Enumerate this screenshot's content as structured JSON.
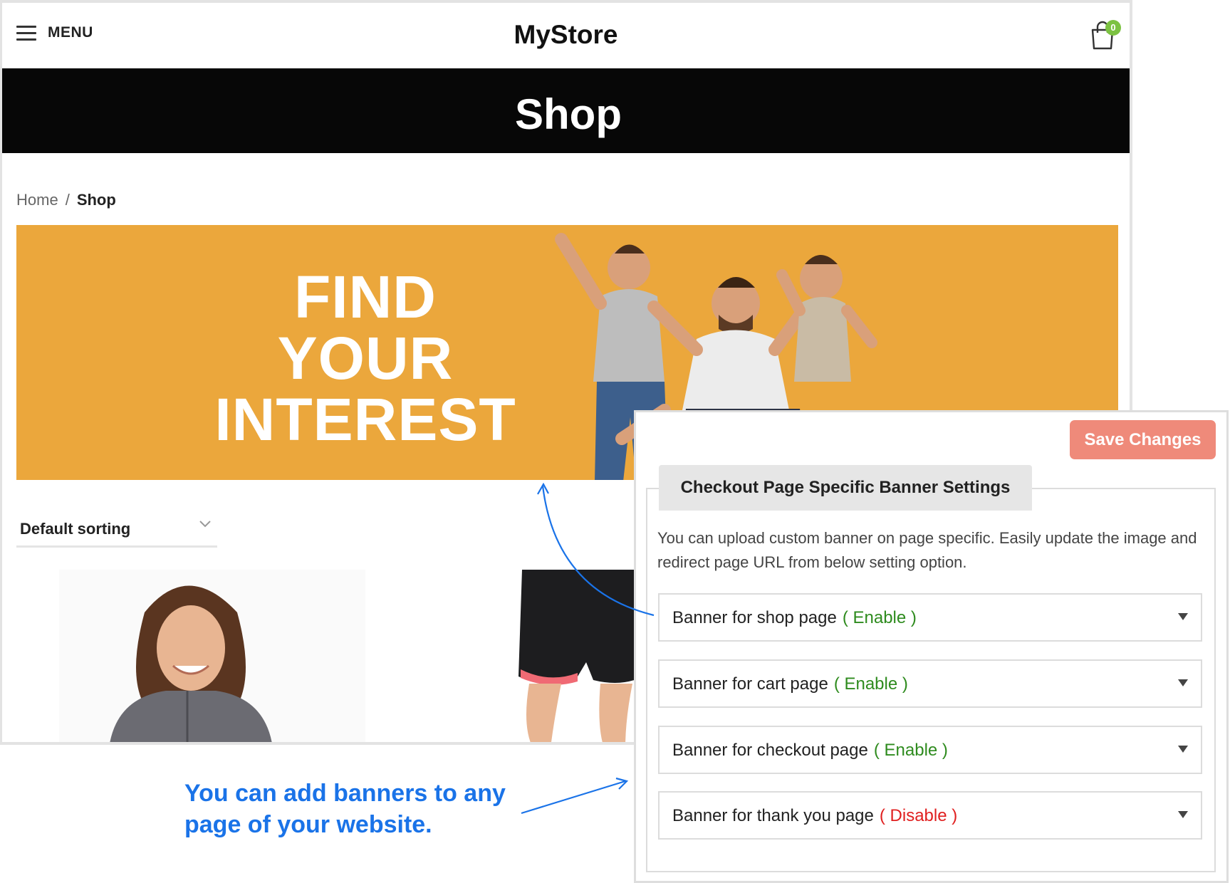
{
  "header": {
    "menu_label": "MENU",
    "logo": "MyStore",
    "cart_count": "0"
  },
  "page_title": "Shop",
  "breadcrumb": {
    "home": "Home",
    "separator": "/",
    "current": "Shop"
  },
  "banner": {
    "line1": "FIND",
    "line2": "YOUR",
    "line3": "INTEREST",
    "background_color": "#eba73c"
  },
  "sorting": {
    "selected": "Default sorting"
  },
  "settings_panel": {
    "save_label": "Save Changes",
    "section_title": "Checkout Page Specific Banner Settings",
    "description": "You can upload custom banner on page specific. Easily update the image and redirect page URL from below setting option.",
    "rows": [
      {
        "label": "Banner for shop page",
        "status": "( Enable )",
        "status_color": "#2e8b1e"
      },
      {
        "label": "Banner for cart page",
        "status": "( Enable )",
        "status_color": "#2e8b1e"
      },
      {
        "label": "Banner for checkout page",
        "status": "( Enable )",
        "status_color": "#2e8b1e"
      },
      {
        "label": "Banner for thank you page",
        "status": "( Disable )",
        "status_color": "#e02020"
      }
    ]
  },
  "annotation": {
    "line1": "You can add banners to any",
    "line2": "page of your website."
  },
  "colors": {
    "accent_blue": "#1a73e8",
    "save_button": "#ef8a7a",
    "cart_badge": "#7cc242"
  }
}
